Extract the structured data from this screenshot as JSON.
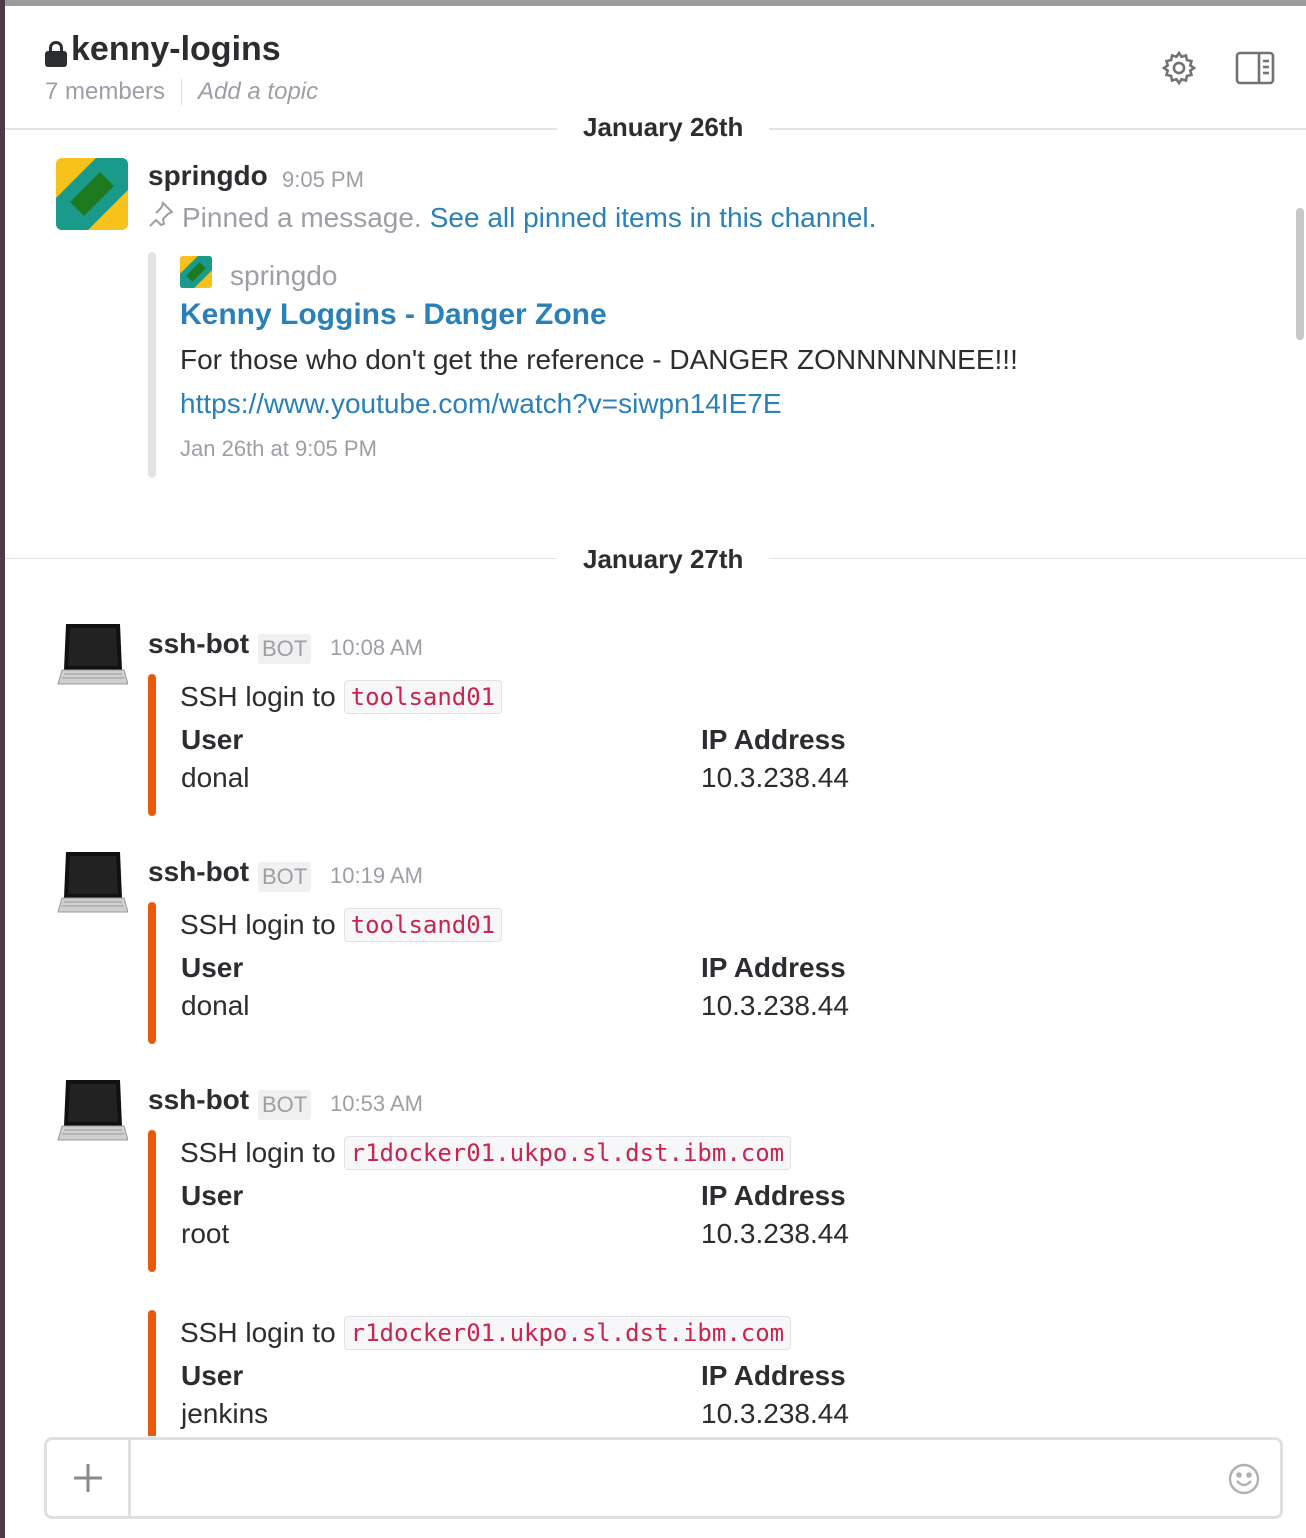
{
  "channel": {
    "name": "kenny-logins",
    "members": "7 members",
    "topic_placeholder": "Add a topic"
  },
  "dividers": [
    "January 26th",
    "January 27th"
  ],
  "pinned_message": {
    "user": "springdo",
    "time": "9:05 PM",
    "text": "Pinned a message.",
    "link": "See all pinned items in this channel.",
    "attachment": {
      "author": "springdo",
      "title": "Kenny Loggins - Danger Zone",
      "text": "For those who don't get the reference - DANGER ZONNNNNNEE!!!",
      "url": "https://www.youtube.com/watch?v=siwpn14IE7E",
      "footer": "Jan 26th at 9:05 PM"
    }
  },
  "bot_messages": [
    {
      "user": "ssh-bot",
      "badge": "BOT",
      "time": "10:08 AM",
      "login_label": "SSH login to",
      "host": "toolsand01",
      "user_title": "User",
      "user_value": "donal",
      "ip_title": "IP Address",
      "ip_value": "10.3.238.44"
    },
    {
      "user": "ssh-bot",
      "badge": "BOT",
      "time": "10:19 AM",
      "login_label": "SSH login to",
      "host": "toolsand01",
      "user_title": "User",
      "user_value": "donal",
      "ip_title": "IP Address",
      "ip_value": "10.3.238.44"
    },
    {
      "user": "ssh-bot",
      "badge": "BOT",
      "time": "10:53 AM",
      "login_label": "SSH login to",
      "host": "r1docker01.ukpo.sl.dst.ibm.com",
      "user_title": "User",
      "user_value": "root",
      "ip_title": "IP Address",
      "ip_value": "10.3.238.44"
    },
    {
      "login_label": "SSH login to",
      "host": "r1docker01.ukpo.sl.dst.ibm.com",
      "user_title": "User",
      "user_value": "jenkins",
      "ip_title": "IP Address",
      "ip_value": "10.3.238.44"
    }
  ],
  "composer": {
    "plus": "+",
    "placeholder": ""
  },
  "colors": {
    "link": "#2a80b9",
    "bot_bar": "#e8590c",
    "muted": "#9e9ea6"
  },
  "icons": [
    "lock-icon",
    "gear-icon",
    "sidebar-toggle-icon",
    "pin-icon",
    "laptop-icon",
    "plus-icon",
    "emoji-icon"
  ]
}
